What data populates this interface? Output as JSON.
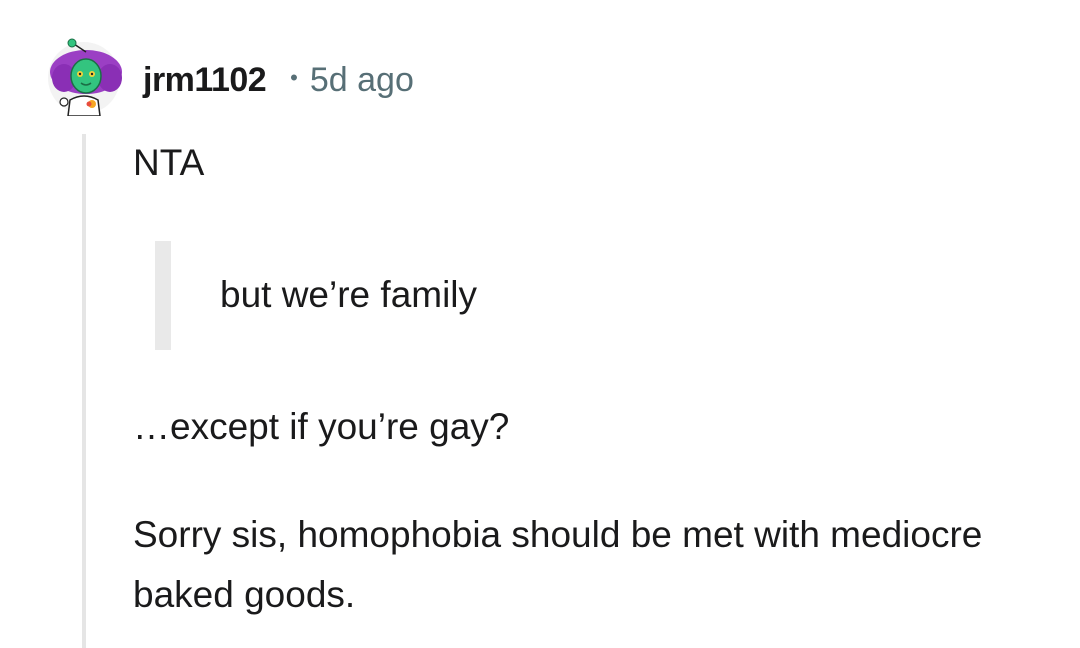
{
  "comment": {
    "username": "jrm1102",
    "separator": "•",
    "timestamp": "5d ago",
    "paragraphs": {
      "p1": "NTA",
      "quote": "but we’re family",
      "p2": "…except if you’re gay?",
      "p3": "Sorry sis, homophobia should be met with mediocre baked goods."
    }
  },
  "colors": {
    "text": "#1a1a1b",
    "meta": "#576f76",
    "thread_line": "#e5e5e5",
    "quote_bar": "#e9e9e9",
    "avatar_hair": "#9b3fc4",
    "avatar_skin": "#33c47f"
  },
  "icons": {
    "avatar": "snoo-avatar-icon"
  }
}
